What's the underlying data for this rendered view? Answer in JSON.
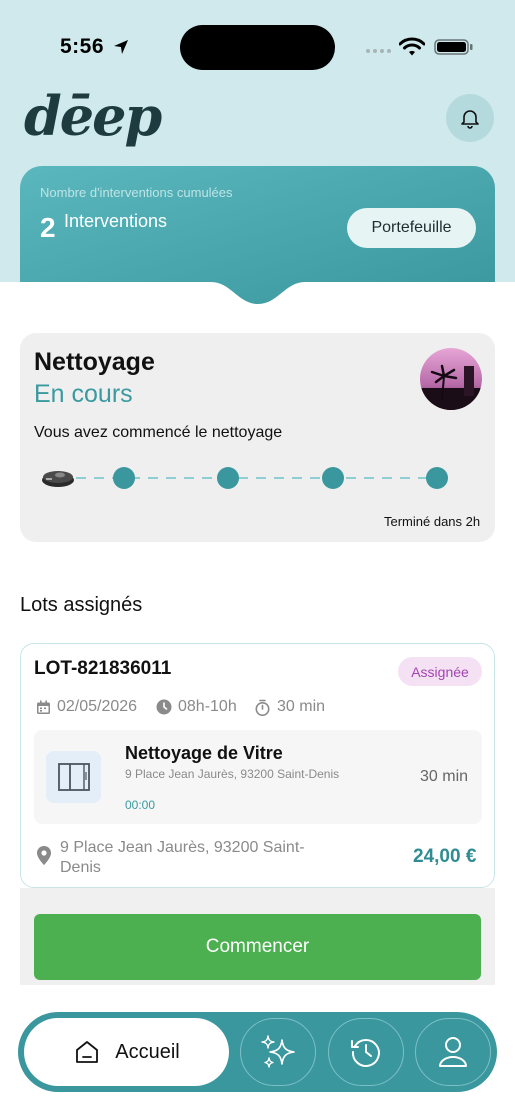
{
  "status_bar": {
    "time": "5:56"
  },
  "header": {
    "logo": "dēep"
  },
  "summary": {
    "subtitle": "Nombre d'interventions cumulées",
    "count": "2",
    "count_label": "Interventions",
    "wallet_label": "Portefeuille"
  },
  "progress": {
    "title": "Nettoyage",
    "status": "En cours",
    "description": "Vous avez commencé le nettoyage",
    "eta": "Terminé dans 2h",
    "steps_total": 4
  },
  "section_title": "Lots assignés",
  "lot": {
    "id": "LOT-821836011",
    "badge": "Assignée",
    "date": "02/05/2026",
    "slot": "08h-10h",
    "duration": "30 min",
    "service": {
      "name": "Nettoyage de Vitre",
      "address": "9 Place Jean Jaurès, 93200 Saint-Denis",
      "time": "00:00",
      "duration": "30 min"
    },
    "address": "9 Place Jean Jaurès, 93200 Saint-Denis",
    "price": "24,00 €",
    "start_label": "Commencer"
  },
  "tabbar": {
    "home_label": "Accueil"
  },
  "colors": {
    "teal": "#3a979e",
    "green": "#4caf50",
    "badge": "#a244b0"
  }
}
